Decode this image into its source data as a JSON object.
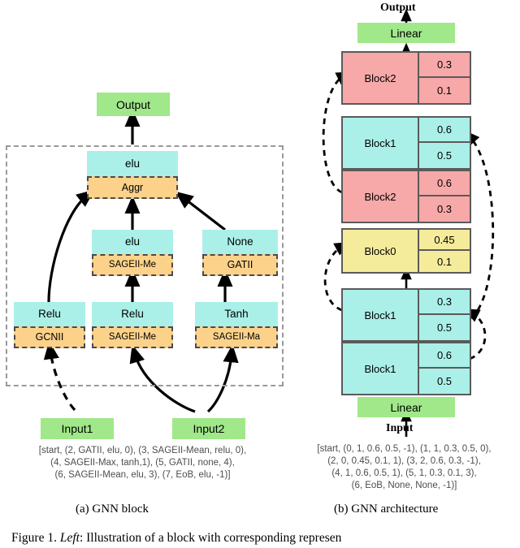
{
  "figure": {
    "caption_prefix": "Figure 1.",
    "caption_emph": "Left",
    "caption_rest": ": Illustration of a block with corresponding represen"
  },
  "panel_a": {
    "subcaption": "(a)  GNN block",
    "output_label": "Output",
    "inputs": [
      {
        "name": "input1",
        "label": "Input1"
      },
      {
        "name": "input2",
        "label": "Input2"
      }
    ],
    "nodes": [
      {
        "id": "n_aggr",
        "activation": "elu",
        "op": "Aggr"
      },
      {
        "id": "n_mid",
        "activation": "elu",
        "op": "SAGEII-Me"
      },
      {
        "id": "n_right",
        "activation": "None",
        "op": "GATII"
      },
      {
        "id": "n_l1",
        "activation": "Relu",
        "op": "GCNII"
      },
      {
        "id": "n_l2",
        "activation": "Relu",
        "op": "SAGEII-Me"
      },
      {
        "id": "n_l3",
        "activation": "Tanh",
        "op": "SAGEII-Ma"
      }
    ],
    "sequence_lines": [
      "[start, (2, GATII, elu, 0), (3, SAGEII-Mean, relu, 0),",
      "(4, SAGEII-Max, tanh,1), (5, GATII, none, 4),",
      "(6, SAGEII-Mean, elu, 3), (7, EoB, elu, -1)]"
    ]
  },
  "panel_b": {
    "subcaption": "(b)  GNN architecture",
    "output_label": "Output",
    "input_label": "Input",
    "top_linear_label": "Linear",
    "bottom_linear_label": "Linear",
    "blocks": [
      {
        "name": "Block2",
        "v1": "0.3",
        "v2": "0.1",
        "color": "pink"
      },
      {
        "name": "Block1",
        "v1": "0.6",
        "v2": "0.5",
        "color": "cyan"
      },
      {
        "name": "Block2",
        "v1": "0.6",
        "v2": "0.3",
        "color": "pink"
      },
      {
        "name": "Block0",
        "v1": "0.45",
        "v2": "0.1",
        "color": "yellow"
      },
      {
        "name": "Block1",
        "v1": "0.3",
        "v2": "0.5",
        "color": "cyan"
      },
      {
        "name": "Block1",
        "v1": "0.6",
        "v2": "0.5",
        "color": "cyan"
      }
    ],
    "sequence_lines": [
      "[start, (0, 1, 0.6, 0.5, -1), (1, 1, 0.3, 0.5, 0),",
      "(2, 0, 0.45, 0.1, 1), (3, 2, 0.6, 0.3, -1),",
      "(4, 1, 0.6, 0.5, 1), (5, 1, 0.3, 0.1, 3),",
      "(6, EoB, None, None, -1)]"
    ]
  },
  "colors": {
    "cyan": "#aaf0e8",
    "orange": "#fcd28a",
    "green": "#a0e88a",
    "pink": "#f7a8a8",
    "yellow": "#f5ec9b",
    "block_border": "#5a5a5a",
    "frame_dash": "#9a9a9a"
  }
}
